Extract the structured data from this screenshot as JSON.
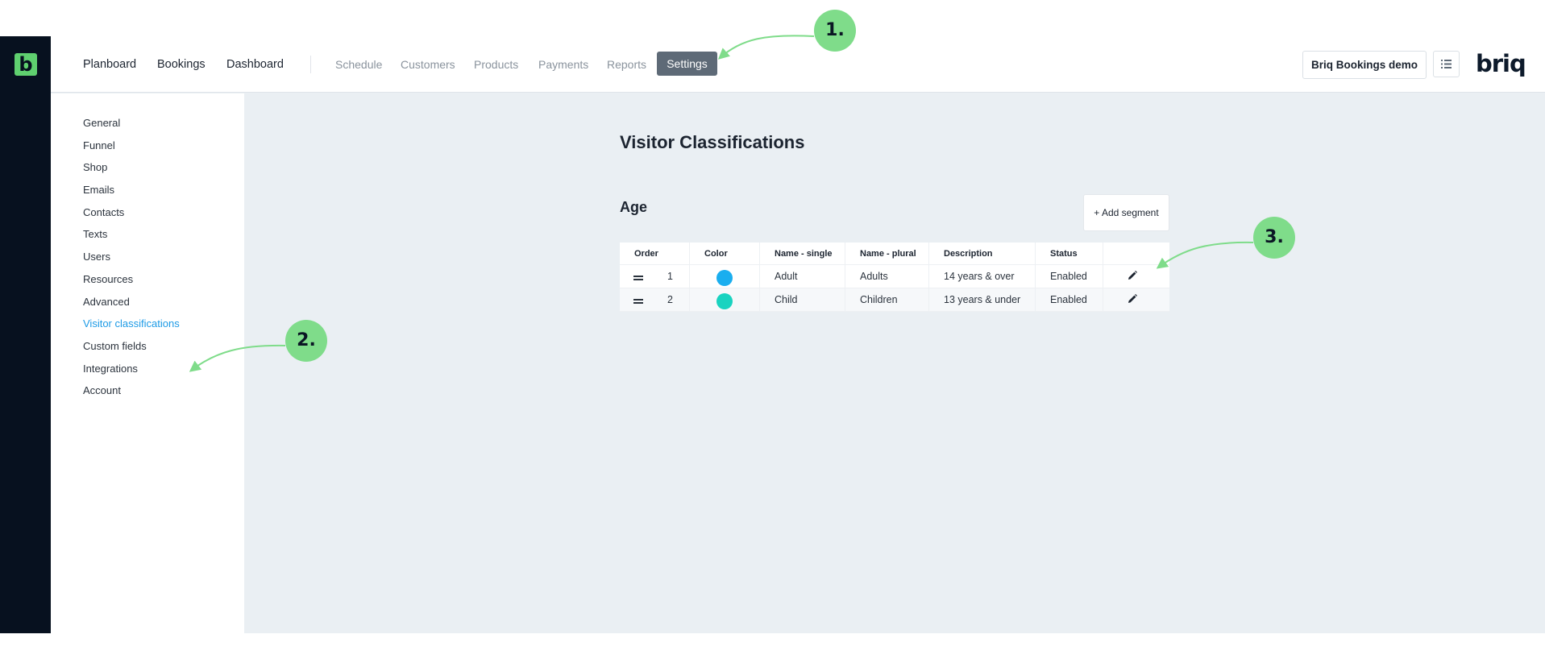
{
  "topbar": {
    "primary_nav": [
      "Planboard",
      "Bookings",
      "Dashboard"
    ],
    "secondary_nav": [
      "Schedule",
      "Customers",
      "Products",
      "Payments",
      "Reports"
    ],
    "active_nav": "Settings",
    "account_button": "Briq Bookings demo",
    "brand": "briq"
  },
  "logo_letter": "b",
  "sidebar": {
    "items": [
      "General",
      "Funnel",
      "Shop",
      "Emails",
      "Contacts",
      "Texts",
      "Users",
      "Resources",
      "Advanced",
      "Visitor classifications",
      "Custom fields",
      "Integrations",
      "Account"
    ],
    "active_index": 9
  },
  "main": {
    "title": "Visitor Classifications",
    "section": "Age",
    "add_button": "+ Add segment",
    "table": {
      "headers": [
        "Order",
        "Color",
        "Name - single",
        "Name - plural",
        "Description",
        "Status"
      ],
      "rows": [
        {
          "order": "1",
          "color": "#1aaeef",
          "name_single": "Adult",
          "name_plural": "Adults",
          "description": "14 years & over",
          "status": "Enabled"
        },
        {
          "order": "2",
          "color": "#19d3c0",
          "name_single": "Child",
          "name_plural": "Children",
          "description": "13 years & under",
          "status": "Enabled"
        }
      ]
    }
  },
  "annotations": [
    "1.",
    "2.",
    "3."
  ],
  "colors": {
    "rail": "#07111f",
    "logo": "#5fd06f",
    "callout": "#7fdc8a",
    "active_link": "#1e9be6",
    "settings_pill": "#5e6a77"
  }
}
